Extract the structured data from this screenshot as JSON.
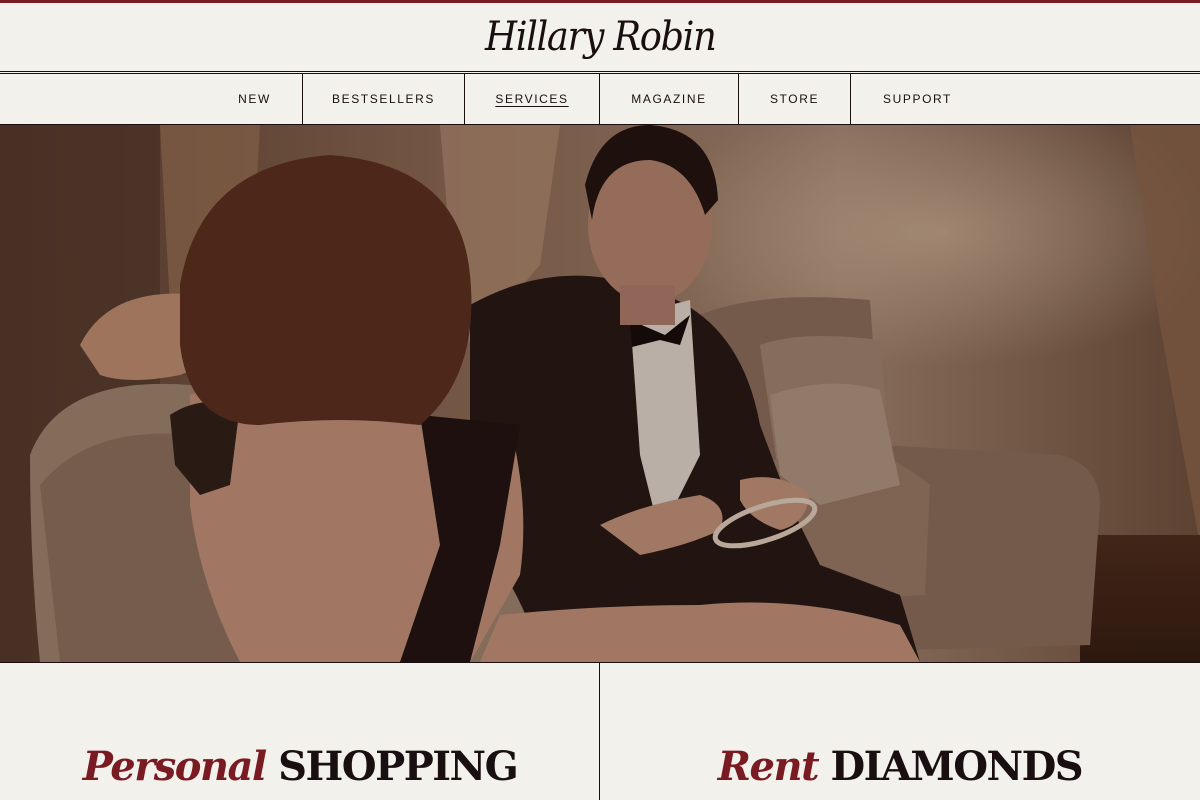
{
  "brand": {
    "name": "Hillary Robin",
    "accent_color": "#7a1a22"
  },
  "nav": {
    "items": [
      {
        "label": "NEW"
      },
      {
        "label": "BESTSELLERS"
      },
      {
        "label": "SERVICES",
        "active": true
      },
      {
        "label": "MAGAZINE"
      },
      {
        "label": "STORE"
      },
      {
        "label": "SUPPORT"
      }
    ]
  },
  "hero": {
    "image": "couple-on-sofa-viewing-diamond-bracelet"
  },
  "panels": [
    {
      "script": "Personal",
      "caps": "SHOPPING"
    },
    {
      "script": "Rent",
      "caps": "DIAMONDS"
    }
  ]
}
